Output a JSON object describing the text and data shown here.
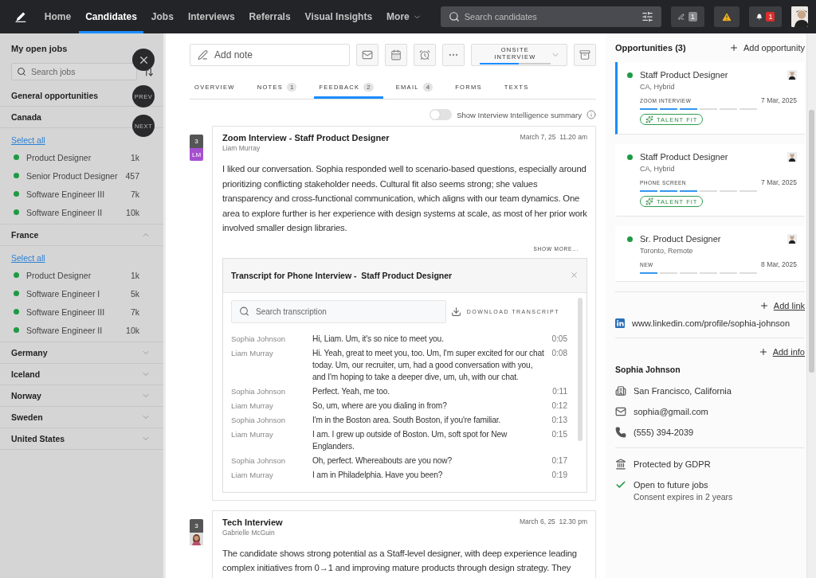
{
  "nav": {
    "items": [
      {
        "label": "Home",
        "selected": false
      },
      {
        "label": "Candidates",
        "selected": true
      },
      {
        "label": "Jobs",
        "selected": false
      },
      {
        "label": "Interviews",
        "selected": false
      },
      {
        "label": "Referrals",
        "selected": false
      },
      {
        "label": "Visual Insights",
        "selected": false
      },
      {
        "label": "More",
        "selected": false,
        "kind": "menu"
      }
    ],
    "search": {
      "placeholder": "Search candidates"
    },
    "actions": [
      {
        "kind": "notes",
        "badge": "1"
      },
      {
        "kind": "warning"
      },
      {
        "kind": "notifications",
        "badge": "1"
      },
      {
        "kind": "avatar"
      }
    ]
  },
  "sidebar": {
    "title": "My open jobs",
    "search": {
      "placeholder": "Search jobs"
    },
    "floating_buttons": [
      {
        "kind": "close"
      },
      {
        "kind": "text",
        "label": "PREV"
      },
      {
        "kind": "text",
        "label": "NEXT"
      }
    ],
    "groups": [
      {
        "name": "General opportunities"
      },
      {
        "name": "Canada",
        "select_all": "Select all",
        "items": [
          {
            "name": "Product Designer",
            "count": "1k",
            "color": "#1e9a45"
          },
          {
            "name": "Senior Product Designer",
            "count": "457",
            "color": "#1e9a45"
          },
          {
            "name": "Software Engineer III",
            "count": "7k",
            "color": "#1e9a45"
          },
          {
            "name": "Software Engineer II",
            "count": "10k",
            "color": "#1e9a45"
          }
        ]
      },
      {
        "name": "France",
        "expanded": true,
        "select_all": "Select all",
        "items": [
          {
            "name": "Product Designer",
            "count": "1k",
            "color": "#1e9a45"
          },
          {
            "name": "Software Engineer I",
            "count": "5k",
            "color": "#1e9a45"
          },
          {
            "name": "Software Engineer III",
            "count": "7k",
            "color": "#1e9a45"
          },
          {
            "name": "Software Engineer II",
            "count": "10k",
            "color": "#1e9a45"
          }
        ]
      },
      {
        "name": "Germany",
        "expanded": false
      },
      {
        "name": "Iceland",
        "expanded": false
      },
      {
        "name": "Norway",
        "expanded": false
      },
      {
        "name": "Sweden",
        "expanded": false
      },
      {
        "name": "United States",
        "expanded": false
      }
    ]
  },
  "toolbar": {
    "note": {
      "placeholder": "Add note"
    },
    "buttons": [
      {
        "kind": "email"
      },
      {
        "kind": "calendar"
      },
      {
        "kind": "alarm"
      },
      {
        "kind": "more"
      },
      {
        "kind": "stage",
        "label": "ONSITE INTERVIEW",
        "level": 0.55
      },
      {
        "kind": "archive"
      }
    ]
  },
  "tabs": [
    {
      "label": "OVERVIEW",
      "selected": false
    },
    {
      "label": "NOTES",
      "count": "1",
      "selected": false
    },
    {
      "label": "FEEDBACK",
      "count": "2",
      "selected": true
    },
    {
      "label": "EMAIL",
      "count": "4",
      "selected": false
    },
    {
      "label": "FORMS",
      "selected": false
    },
    {
      "label": "TEXTS",
      "selected": false
    }
  ],
  "intelligence_toggle": {
    "label": "Show Interview Intelligence summary",
    "on": false
  },
  "feedback": [
    {
      "count": "3",
      "reviewer": {
        "kind": "initials",
        "text": "LM",
        "color": "#a64fd0"
      },
      "title": "Zoom Interview - Staff Product Designer",
      "author": "Liam Murray",
      "date": "March 7, 25  11.20 am",
      "body": "I liked our conversation. Sophia responded well to scenario-based questions, especially around prioritizing conflicting stakeholder needs. Cultural fit also seems strong; she values transparency and cross-functional communication, which aligns with our team dynamics. One area to explore further is her experience with design systems at scale, as most of her prior work involved smaller design libraries.",
      "show_more": "SHOW MORE...",
      "transcript": {
        "title": "Transcript for Phone Interview -  Staff Product Designer",
        "search": {
          "placeholder": "Search transcription"
        },
        "download": "DOWNLOAD TRANSCRIPT",
        "lines": [
          {
            "speaker": "Sophia Johnson",
            "text": "Hi, Liam. Um, it's so nice to meet you.",
            "time": "0:05"
          },
          {
            "speaker": "Liam Murray",
            "text": "Hi. Yeah, great to meet you, too. Um, I'm super excited for our chat today. Um, our recruiter, um, had a good conversation with you, and I'm hoping to take a deeper dive, um, uh, with our chat.",
            "time": "0:08"
          },
          {
            "speaker": "Sophia Johnson",
            "text": "Perfect. Yeah, me too.",
            "time": "0:11"
          },
          {
            "speaker": "Liam Murray",
            "text": "So, um, where are you dialing in from?",
            "time": "0:12"
          },
          {
            "speaker": "Sophia Johnson",
            "text": "I'm in the Boston area. South Boston, if you're familiar.",
            "time": "0:13"
          },
          {
            "speaker": "Liam Murray",
            "text": "I am. I grew up outside of Boston. Um, soft spot for New Englanders.",
            "time": "0:15"
          },
          {
            "speaker": "Sophia Johnson",
            "text": "Oh, perfect. Whereabouts are you now?",
            "time": "0:17"
          },
          {
            "speaker": "Liam Murray",
            "text": "I am in Philadelphia. Have you been?",
            "time": "0:19"
          }
        ]
      }
    },
    {
      "count": "3",
      "reviewer": {
        "kind": "photo"
      },
      "title": "Tech Interview",
      "author": "Gabrielle McGuin",
      "date": "March 6, 25  12.30 pm",
      "body": "The candidate shows strong potential as a Staff-level designer, with deep experience leading complex initiatives from 0→1 and improving mature products through design strategy. They"
    }
  ],
  "opportunities": {
    "title": "Opportunities (3)",
    "add": "Add opportunity",
    "items": [
      {
        "title": "Staff Product Designer",
        "location": "CA, Hybrid",
        "stage": "ZOOM INTERVIEW",
        "date": "7 Mar, 2025",
        "level": 0.5,
        "selected": true,
        "talent_fit": "TALENT FIT"
      },
      {
        "title": "Staff Product Designer",
        "location": "CA, Hybrid",
        "stage": "PHONE SCREEN",
        "date": "7 Mar, 2025",
        "level": 0.5,
        "selected": false,
        "talent_fit": "TALENT FIT"
      },
      {
        "title": "Sr. Product Designer",
        "location": "Toronto, Remote",
        "stage": "NEW",
        "date": "8 Mar, 2025",
        "level": 0.17,
        "selected": false
      }
    ]
  },
  "links": {
    "add": "Add link",
    "items": [
      {
        "kind": "linkedin",
        "url": "www.linkedin.com/profile/sophia-johnson"
      }
    ]
  },
  "info": {
    "add": "Add info",
    "name": "Sophia Johnson",
    "fields": [
      {
        "kind": "location",
        "text": "San Francisco, California"
      },
      {
        "kind": "email",
        "text": "sophia@gmail.com"
      },
      {
        "kind": "phone",
        "text": "(555) 394-2039"
      }
    ]
  },
  "privacy": [
    {
      "kind": "gdpr",
      "text": "Protected by GDPR"
    },
    {
      "kind": "consent",
      "text": "Open to future jobs",
      "note": "Consent expires in 2 years"
    }
  ]
}
